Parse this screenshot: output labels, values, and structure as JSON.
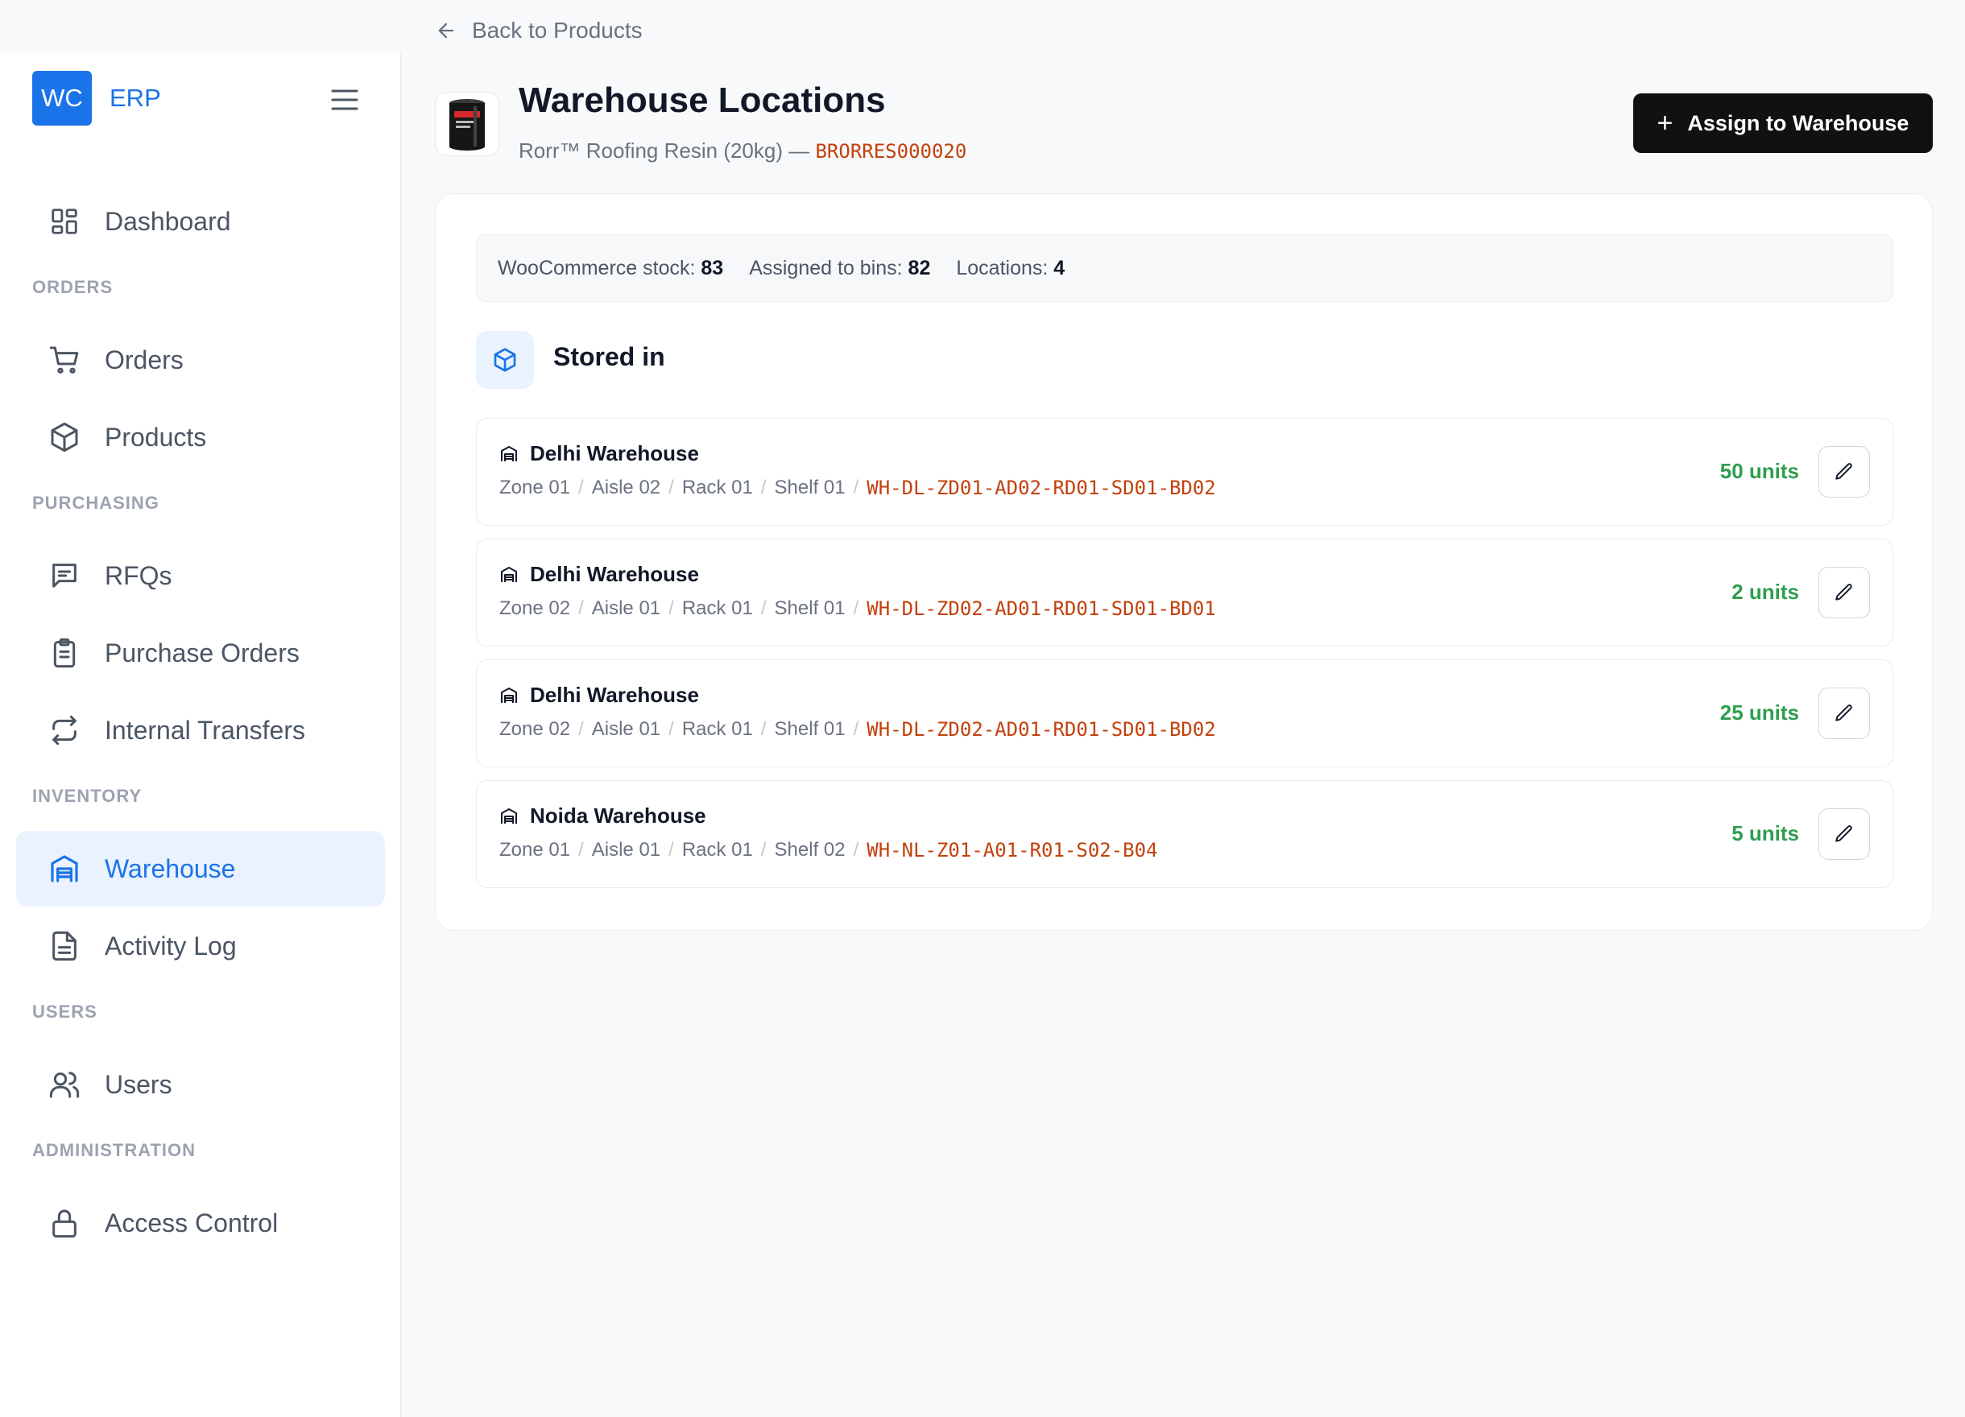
{
  "brand": {
    "logo_box": "WC",
    "logo_text": "ERP"
  },
  "sidebar": {
    "dashboard": {
      "label": "Dashboard",
      "icon": "dashboard-icon"
    },
    "sections": {
      "orders": "ORDERS",
      "purchasing": "PURCHASING",
      "inventory": "INVENTORY",
      "users": "USERS",
      "administration": "ADMINISTRATION"
    },
    "items": {
      "orders": {
        "label": "Orders",
        "icon": "cart-icon"
      },
      "products": {
        "label": "Products",
        "icon": "box-icon"
      },
      "rfqs": {
        "label": "RFQs",
        "icon": "message-icon"
      },
      "purchase_orders": {
        "label": "Purchase Orders",
        "icon": "clipboard-icon"
      },
      "internal_transfers": {
        "label": "Internal Transfers",
        "icon": "transfer-icon"
      },
      "warehouse": {
        "label": "Warehouse",
        "icon": "warehouse-icon",
        "active": true
      },
      "activity_log": {
        "label": "Activity Log",
        "icon": "document-icon"
      },
      "users": {
        "label": "Users",
        "icon": "users-icon"
      },
      "access_control": {
        "label": "Access Control",
        "icon": "lock-icon"
      }
    }
  },
  "header": {
    "back_label": "Back to Products",
    "title": "Warehouse Locations",
    "product_name": "Rorr™ Roofing Resin (20kg) — ",
    "sku": "BRORRES000020",
    "assign_button": "Assign to Warehouse"
  },
  "stats": {
    "woo_label": "WooCommerce stock: ",
    "woo_value": "83",
    "assigned_label": "Assigned to bins: ",
    "assigned_value": "82",
    "locations_label": "Locations: ",
    "locations_value": "4"
  },
  "stored_in": {
    "title": "Stored in",
    "rows": [
      {
        "warehouse": "Delhi Warehouse",
        "zone": "Zone 01",
        "aisle": "Aisle 02",
        "rack": "Rack 01",
        "shelf": "Shelf 01",
        "bin": "WH-DL-ZD01-AD02-RD01-SD01-BD02",
        "units": "50 units"
      },
      {
        "warehouse": "Delhi Warehouse",
        "zone": "Zone 02",
        "aisle": "Aisle 01",
        "rack": "Rack 01",
        "shelf": "Shelf 01",
        "bin": "WH-DL-ZD02-AD01-RD01-SD01-BD01",
        "units": "2 units"
      },
      {
        "warehouse": "Delhi Warehouse",
        "zone": "Zone 02",
        "aisle": "Aisle 01",
        "rack": "Rack 01",
        "shelf": "Shelf 01",
        "bin": "WH-DL-ZD02-AD01-RD01-SD01-BD02",
        "units": "25 units"
      },
      {
        "warehouse": "Noida Warehouse",
        "zone": "Zone 01",
        "aisle": "Aisle 01",
        "rack": "Rack 01",
        "shelf": "Shelf 02",
        "bin": "WH-NL-Z01-A01-R01-S02-B04",
        "units": "5 units"
      }
    ]
  },
  "colors": {
    "accent": "#1a73e8",
    "sku": "#c2410c",
    "units": "#2e9e4d",
    "primary_button": "#111111"
  }
}
